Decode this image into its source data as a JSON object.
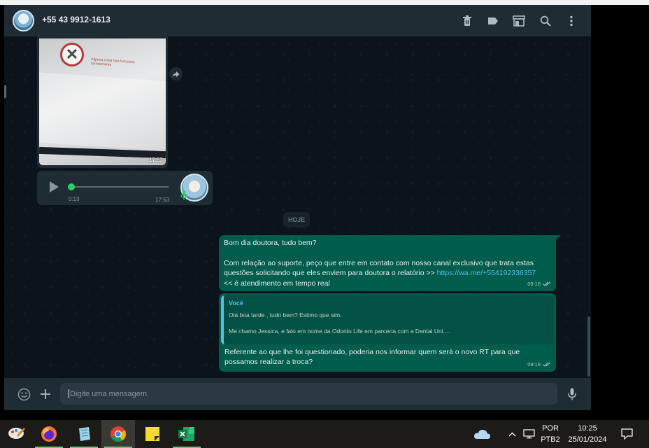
{
  "header": {
    "contact_name": "+55 43 9912-1613",
    "icons": [
      "delete-icon",
      "label-icon",
      "store-icon",
      "search-icon",
      "menu-icon"
    ]
  },
  "image_message": {
    "time": "17:52",
    "error_text": "Alguma coisa nao funcionou corretamente"
  },
  "audio_message": {
    "duration": "0:13",
    "time": "17:53",
    "progress_fraction": 0.0
  },
  "day_badge": "HOJE",
  "messages": [
    {
      "line1": "Bom dia doutora, tudo bem?",
      "line2": "Com relação ao suporte, peço que entre em contato com nosso canal exclusivo que trata estas",
      "line3a": "questões solicitando que eles enviem para doutora o relatório >> ",
      "link": "https://wa.me/+554192336357",
      "line4": "<< é atendimento em tempo real",
      "time": "09:18"
    },
    {
      "quote_author": "Você",
      "quote_line1": "Olá boa tarde , tudo bem? Estimo que sim.",
      "quote_line2": "Me chamo Jessica, e falo em nome da Odonto Life em parceria com a Dental Uni....",
      "body_line1": "Referente ao que lhe foi questionado, poderia nos informar quem será o novo RT para que",
      "body_line2": "possamos realizar a troca?",
      "time": "09:18"
    }
  ],
  "compose": {
    "placeholder": "Digite uma mensagem"
  },
  "taskbar": {
    "apps": [
      "paint-icon",
      "firefox-icon",
      "notepad-icon",
      "chrome-icon",
      "sticky-notes-icon",
      "excel-icon"
    ],
    "language": "POR",
    "layout": "PTB2",
    "time": "10:25",
    "date": "25/01/2024"
  },
  "colors": {
    "accent": "#25d366",
    "outgoing": "#005c4b",
    "link": "#53bdeb",
    "header": "#202c33"
  }
}
